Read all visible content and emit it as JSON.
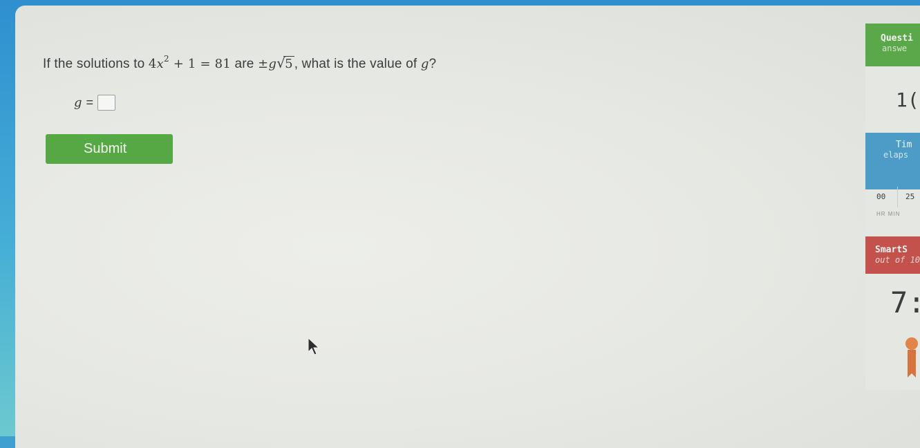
{
  "question": {
    "prefix": "If the solutions to ",
    "coef": "4",
    "var_x": "x",
    "exponent": "2",
    "rest": " + 1 = 81",
    "middle": " are ",
    "pm": "±",
    "var_g": "g",
    "radicand": "5",
    "suffix": ", what is the value of ",
    "ask_var": "g",
    "ask_end": "?"
  },
  "answer": {
    "label_var": "g",
    "equals": "=",
    "value": ""
  },
  "submit": {
    "label": "Submit"
  },
  "sidebar": {
    "questions": {
      "title": "Questi",
      "subtitle": "answe",
      "value": "1("
    },
    "time": {
      "title": "Tim",
      "subtitle": "elaps",
      "hours": "00",
      "minutes": "25",
      "units": "HR   MIN"
    },
    "smartscore": {
      "title": "SmartS",
      "subtitle": "out of 10",
      "value": "7:"
    }
  },
  "colors": {
    "submit": "#56a845",
    "questions_header": "#5aa84a",
    "time_header": "#4d9cc7",
    "smartscore_header": "#c3524c",
    "award": "#e2834a"
  },
  "icons": {
    "cursor": "mouse-pointer-icon",
    "award": "award-ribbon-icon"
  }
}
